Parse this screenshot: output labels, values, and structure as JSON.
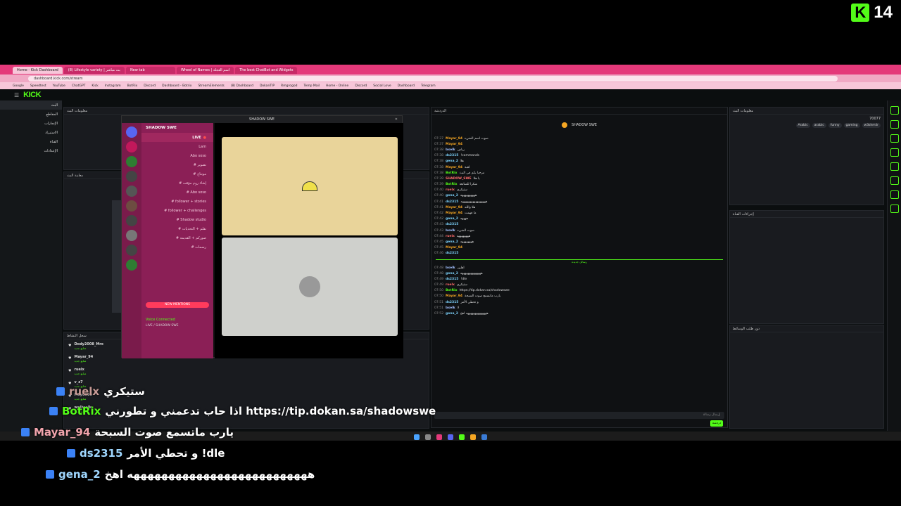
{
  "brand": {
    "letter": "K",
    "number": "14"
  },
  "browser": {
    "tabs": [
      "Home - Kick Dashboard",
      "(8) Lifestyle variety | بث مباشر",
      "New tab",
      "Wheel of Names | اسم العجلة",
      "The best ChatBot and Widgets"
    ],
    "url": "dashboard.kick.com/stream",
    "bookmarks": [
      "Google",
      "Speedtest",
      "YouTube",
      "ChatGPT",
      "Kick",
      "Instagram",
      "BotRix",
      "Discord",
      "Dashboard - Botrix",
      "StreamElements",
      "(8) Dashboard",
      "DokanTIP",
      "Rmgrogod",
      "Temp Mail",
      "Home - Online",
      "Discord",
      "Social Love",
      "Dashboard",
      "Telegram"
    ]
  },
  "kick": {
    "logo": "KICK",
    "nav": [
      "البث",
      "المقاطع",
      "الإنجازات",
      "الاستيراد",
      "القناة",
      "الإعدادات"
    ]
  },
  "panels": {
    "stream_info": "معلومات البث",
    "preview": "معاينة البث",
    "activity": "سجل النشاط",
    "mod_actions": "إجراءات القناة",
    "chat": "الدردشة",
    "chat_input": "إرسال رسالة",
    "requests": "دور طلب الوسائط",
    "send": "دردشة"
  },
  "stream": {
    "title": "SHADOW SWE",
    "viewers": "70077",
    "tags": [
      "Arabic",
      "arabic",
      "funny",
      "gaming",
      "w3shmiir"
    ]
  },
  "discord": {
    "window_title": "SHADOW SWE",
    "server": "SHADOW SWE",
    "live_channel": "LIVE",
    "users": [
      "Lam",
      "Abo soso"
    ],
    "voice_status": "Voice Connected",
    "voice_sub": "LIVE / SHADOW SWE",
    "mentions": "NEW MENTIONS",
    "channels": [
      "تصوير",
      "مونتاج",
      "إشاء روم مؤقت",
      "Abo soso",
      "follower + stories",
      "follower + challenges",
      "Shadow studio",
      "نقلم + التحديات",
      "صوركم + القديمة",
      "رسمات"
    ]
  },
  "chat": {
    "separator": "رسائل جديدة",
    "messages": [
      {
        "t": "07:37",
        "u": "Mayar_94",
        "c": "#f5a623",
        "m": "صوت اسم الشيء"
      },
      {
        "t": "07:37",
        "u": "Mayar_94",
        "c": "#f5a623",
        "m": ""
      },
      {
        "t": "07:38",
        "u": "bxelk",
        "c": "#a3c1ff",
        "m": "رياض"
      },
      {
        "t": "07:38",
        "u": "ds2315",
        "c": "#7dd3fc",
        "m": "!commands"
      },
      {
        "t": "07:38",
        "u": "gena_2",
        "c": "#7dd3fc",
        "m": "هلا"
      },
      {
        "t": "07:38",
        "u": "Mayar_94",
        "c": "#f5a623",
        "m": "لعبة"
      },
      {
        "t": "07:38",
        "u": "BotRix",
        "c": "#53fc18",
        "m": "مرحبا بكم في البث"
      },
      {
        "t": "07:39",
        "u": "SHADOW_SWE",
        "c": "#ff6b6b",
        "m": "يا هلا"
      },
      {
        "t": "07:39",
        "u": "BotRix",
        "c": "#53fc18",
        "m": "شكرا للمتابعة"
      },
      {
        "t": "07:40",
        "u": "ruelx",
        "c": "#ff6b6b",
        "m": "ستيكري"
      },
      {
        "t": "07:40",
        "u": "gena_2",
        "c": "#7dd3fc",
        "m": "ههههههههههه"
      },
      {
        "t": "07:41",
        "u": "ds2315",
        "c": "#7dd3fc",
        "m": "هههههههههههههههههه"
      },
      {
        "t": "07:41",
        "u": "Mayar_94",
        "c": "#f5a623",
        "m": "هلا والله"
      },
      {
        "t": "07:42",
        "u": "Mayar_94",
        "c": "#f5a623",
        "m": "ما فهمت"
      },
      {
        "t": "07:42",
        "u": "gena_2",
        "c": "#7dd3fc",
        "m": "ههههه"
      },
      {
        "t": "07:43",
        "u": "ds2315",
        "c": "#7dd3fc",
        "m": ""
      },
      {
        "t": "07:43",
        "u": "bxelk",
        "c": "#a3c1ff",
        "m": "صوت الشيء"
      },
      {
        "t": "07:44",
        "u": "ruelx",
        "c": "#ff6b6b",
        "m": "ههههههههه"
      },
      {
        "t": "07:45",
        "u": "gena_2",
        "c": "#7dd3fc",
        "m": "ههههههههه"
      },
      {
        "t": "07:45",
        "u": "Mayar_94",
        "c": "#f5a623",
        "m": ""
      },
      {
        "t": "07:46",
        "u": "ds2315",
        "c": "#7dd3fc",
        "m": ""
      }
    ],
    "after": [
      {
        "t": "07:48",
        "u": "bxelk",
        "c": "#a3c1ff",
        "m": "اهلين"
      },
      {
        "t": "07:48",
        "u": "gena_2",
        "c": "#7dd3fc",
        "m": "ههههههههههههههه"
      },
      {
        "t": "07:49",
        "u": "ds2315",
        "c": "#7dd3fc",
        "m": "!dle"
      },
      {
        "t": "07:49",
        "u": "ruelx",
        "c": "#ff6b6b",
        "m": "ستيكري"
      },
      {
        "t": "07:50",
        "u": "BotRix",
        "c": "#53fc18",
        "m": "https://tip.dokan.sa/shadowswe"
      },
      {
        "t": "07:50",
        "u": "Mayar_94",
        "c": "#f5a623",
        "m": "يارب ماتسمع صوت السبحة"
      },
      {
        "t": "07:51",
        "u": "ds2315",
        "c": "#7dd3fc",
        "m": "و تحطي الأمر"
      },
      {
        "t": "07:51",
        "u": "bxelk",
        "c": "#a3c1ff",
        "m": "لا"
      },
      {
        "t": "07:52",
        "u": "gena_2",
        "c": "#7dd3fc",
        "m": "ههههههههههههههه اهخ"
      }
    ]
  },
  "activity": [
    {
      "u": "Dody2008_Mrx",
      "s": "متابع جديد"
    },
    {
      "u": "Mayar_94",
      "s": "متابع جديد"
    },
    {
      "u": "ruelx",
      "s": "متابع جديد"
    },
    {
      "u": "v_z7",
      "s": "متابع جديد"
    },
    {
      "u": "Mayo566",
      "s": "متابع جديد"
    },
    {
      "u": "wallwalk",
      "s": "متابع جديد"
    }
  ],
  "overlay": [
    {
      "u": "ruelx",
      "m": "ستيكري",
      "c": "#c89b96"
    },
    {
      "u": "BotRix",
      "m": "اذا حاب تدعمني و تطورني https://tip.dokan.sa/shadowswe",
      "c": "#53fc18"
    },
    {
      "u": "Mayar_94",
      "m": "يارب ماتسمع صوت السبحة",
      "c": "#f3a5ad"
    },
    {
      "u": "ds2315",
      "m": "و تحطي الأمر !dle",
      "c": "#9fd7ff"
    },
    {
      "u": "gena_2",
      "m": "ههههههههههههههههههههههههههه اهخ",
      "c": "#9fd7ff"
    }
  ],
  "colors": {
    "kick_green": "#53fc18",
    "browser_pink": "#e4397a",
    "discord_pink": "#8b1f56"
  }
}
